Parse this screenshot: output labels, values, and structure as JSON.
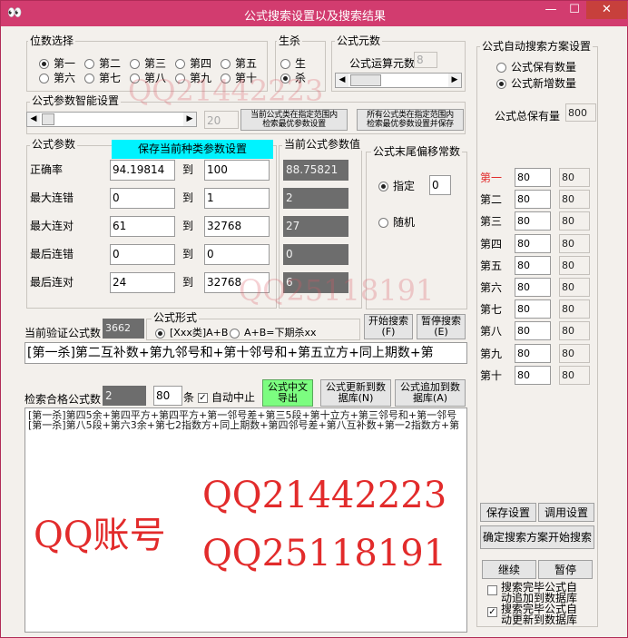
{
  "title": "公式搜索设置以及搜索结果",
  "app_icon": "binoculars-icon",
  "colors": {
    "titlebar": "#d23c6f",
    "close": "#c7403c",
    "cyan": "#00f3ff",
    "green": "#7cfd80",
    "red_text": "#e22b2b"
  },
  "window_buttons": {
    "minimize": "—",
    "maximize": "☐",
    "close": "✕"
  },
  "digit_select": {
    "legend": "位数选择",
    "options": [
      {
        "label": "第一",
        "checked": true
      },
      {
        "label": "第二",
        "checked": false
      },
      {
        "label": "第三",
        "checked": false
      },
      {
        "label": "第四",
        "checked": false
      },
      {
        "label": "第五",
        "checked": false
      },
      {
        "label": "第六",
        "checked": false
      },
      {
        "label": "第七",
        "checked": false
      },
      {
        "label": "第八",
        "checked": false
      },
      {
        "label": "第九",
        "checked": false
      },
      {
        "label": "第十",
        "checked": false
      }
    ]
  },
  "shengsha": {
    "legend": "生杀",
    "options": [
      {
        "label": "生",
        "checked": false
      },
      {
        "label": "杀",
        "checked": true
      }
    ]
  },
  "formula_elements": {
    "legend": "公式元数",
    "label": "公式运算元数",
    "value": "8"
  },
  "smart_params": {
    "legend": "公式参数智能设置",
    "value": "20",
    "btn_current": "当前公式类在指定范围内\n检索最优参数设置",
    "btn_all": "所有公式类在指定范围内\n检索最优参数设置并保存"
  },
  "params": {
    "legend": "公式参数",
    "save_btn": "保存当前种类参数设置",
    "current_legend": "当前公式参数值",
    "to": "到",
    "rows": [
      {
        "label": "正确率",
        "from": "94.19814",
        "to": "100",
        "current": "88.75821"
      },
      {
        "label": "最大连错",
        "from": "0",
        "to": "1",
        "current": "2"
      },
      {
        "label": "最大连对",
        "from": "61",
        "to": "32768",
        "current": "27"
      },
      {
        "label": "最后连错",
        "from": "0",
        "to": "0",
        "current": "0"
      },
      {
        "label": "最后连对",
        "from": "24",
        "to": "32768",
        "current": "6"
      }
    ]
  },
  "tail_offset": {
    "legend": "公式末尾偏移常数",
    "specify": "指定",
    "specify_value": "0",
    "random": "随机",
    "specify_checked": true
  },
  "verify": {
    "label": "当前验证公式数",
    "value": "3662",
    "form_legend": "公式形式",
    "form1": "[Xxx类]A+B",
    "form2": "A+B=下期杀xx",
    "start_btn": "开始搜索\n(F)",
    "pause_btn": "暂停搜索\n(E)",
    "formula_text": "[第一杀]第二互补数+第九邻号和+第十邻号和+第五立方+同上期数+第"
  },
  "qualified": {
    "label": "检索合格公式数",
    "value": "2",
    "limit": "80",
    "unit": "条",
    "auto_stop": "自动中止",
    "auto_stop_checked": true,
    "export_btn": "公式中文\n导出",
    "update_btn": "公式更新到数\n据库(N)",
    "append_btn": "公式追加到数\n据库(A)"
  },
  "results": [
    "[第一杀]第四5余+第四平方+第四平方+第一邻号差+第三5段+第十立方+第三邻号和+第一邻号",
    "[第一杀]第八5段+第六3余+第七2指数方+同上期数+第四邻号差+第八互补数+第一2指数方+第"
  ],
  "watermarks": {
    "qq1": "QQ21442223",
    "qq2": "QQ25118191",
    "account_label": "QQ账号"
  },
  "auto_plan": {
    "legend": "公式自动搜索方案设置",
    "keep_count": "公式保有数量",
    "add_count": "公式新增数量",
    "add_checked": true,
    "total_label": "公式总保有量",
    "total_value": "800",
    "digits": [
      {
        "label": "第一",
        "v1": "80",
        "v2": "80"
      },
      {
        "label": "第二",
        "v1": "80",
        "v2": "80"
      },
      {
        "label": "第三",
        "v1": "80",
        "v2": "80"
      },
      {
        "label": "第四",
        "v1": "80",
        "v2": "80"
      },
      {
        "label": "第五",
        "v1": "80",
        "v2": "80"
      },
      {
        "label": "第六",
        "v1": "80",
        "v2": "80"
      },
      {
        "label": "第七",
        "v1": "80",
        "v2": "80"
      },
      {
        "label": "第八",
        "v1": "80",
        "v2": "80"
      },
      {
        "label": "第九",
        "v1": "80",
        "v2": "80"
      },
      {
        "label": "第十",
        "v1": "80",
        "v2": "80"
      }
    ],
    "save_btn": "保存设置",
    "load_btn": "调用设置",
    "confirm_btn": "确定搜索方案开始搜索",
    "continue_btn": "继续",
    "pause_btn": "暂停",
    "chk1": "搜索完毕公式自\n动追加到数据库",
    "chk1_checked": false,
    "chk2": "搜索完毕公式自\n动更新到数据库",
    "chk2_checked": true
  }
}
